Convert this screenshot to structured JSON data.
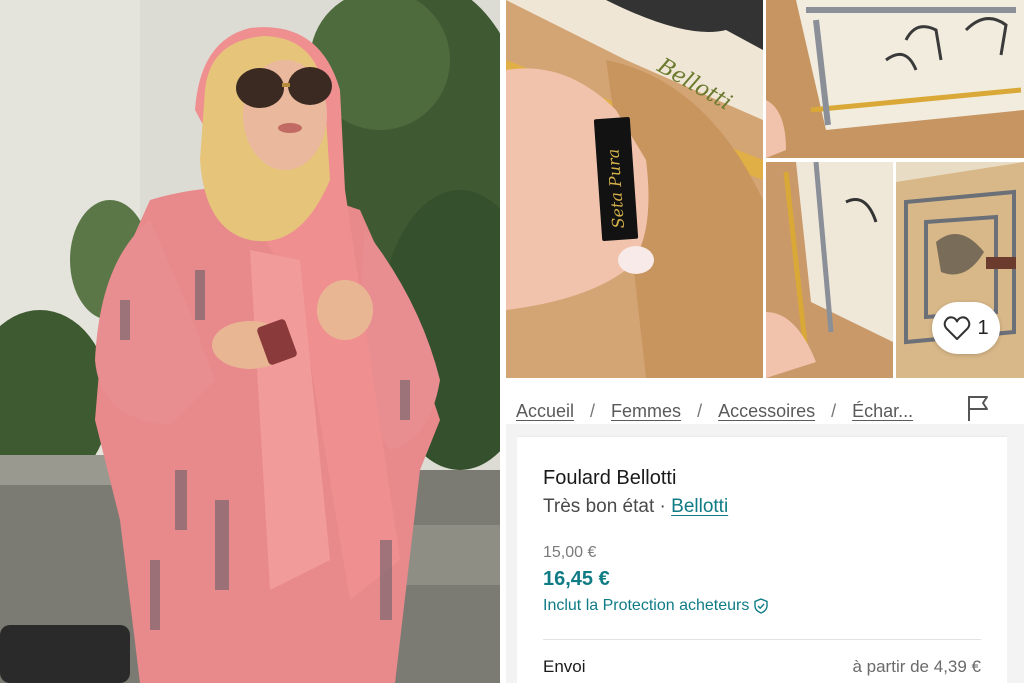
{
  "gallery": {
    "label_text": "Seta Pura",
    "like_count": "1"
  },
  "breadcrumb": {
    "items": [
      "Accueil",
      "Femmes",
      "Accessoires",
      "Échar..."
    ],
    "separator": "/"
  },
  "product": {
    "title": "Foulard Bellotti",
    "condition": "Très bon état · ",
    "brand": "Bellotti",
    "price_original": "15,00 €",
    "price_total": "16,45 €",
    "protection_text": "Inclut la Protection acheteurs",
    "shipping_label": "Envoi",
    "shipping_value": "à partir de 4,39 €"
  },
  "colors": {
    "accent": "#0f7c85",
    "dress_pink": "#e88a8c",
    "scarf_tan": "#c99b68"
  }
}
